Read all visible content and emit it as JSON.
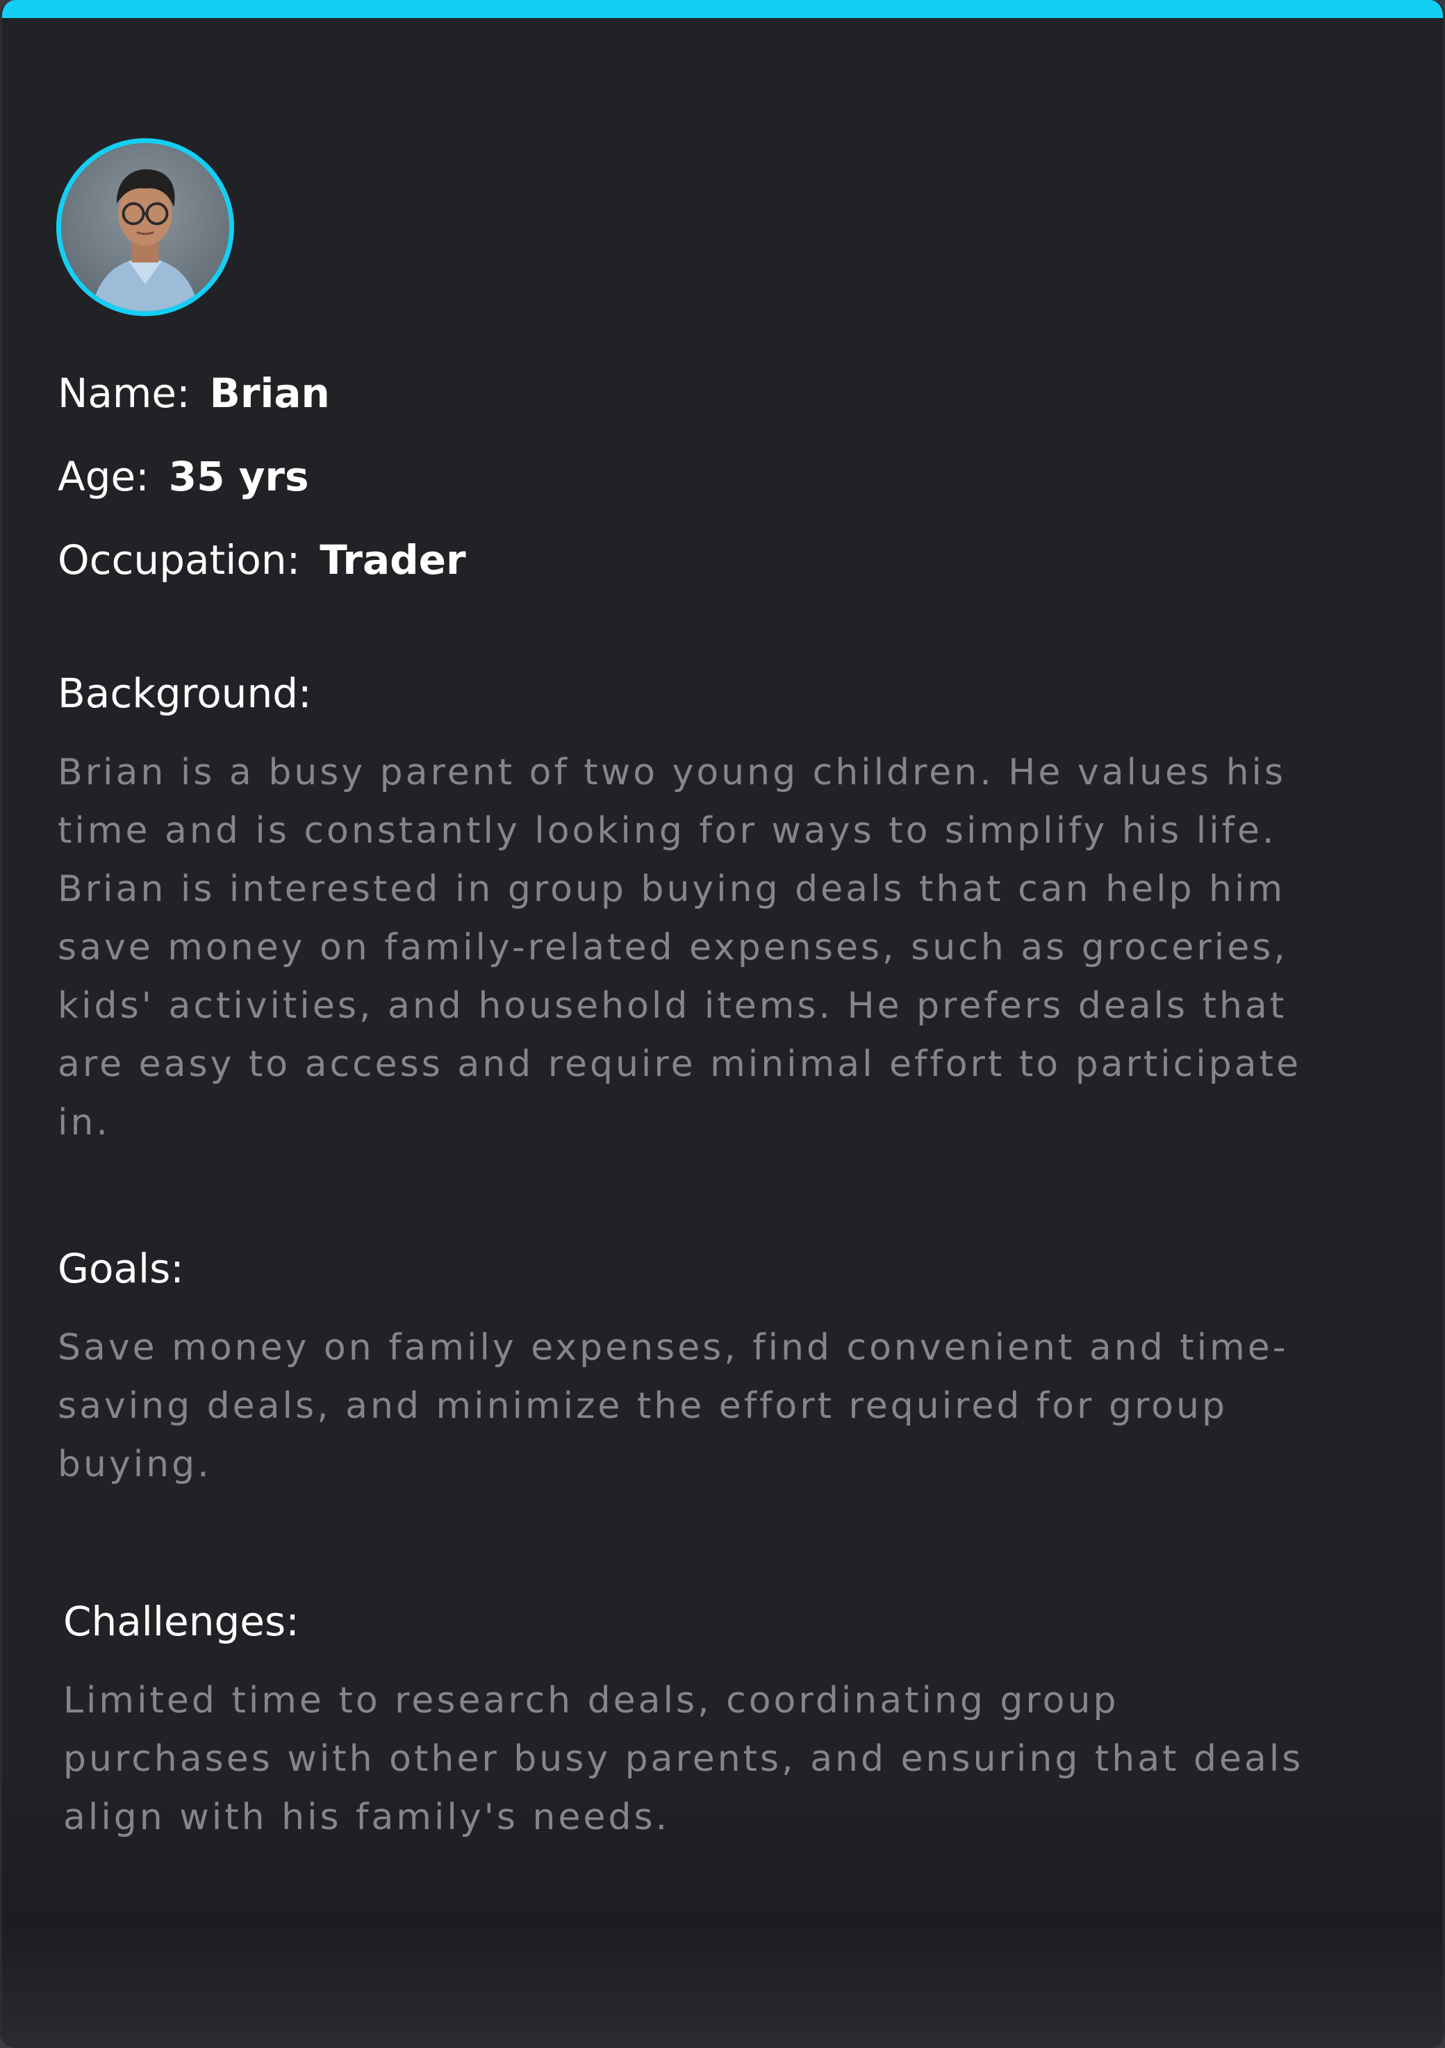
{
  "persona": {
    "avatar_alt": "avatar",
    "fields": {
      "name_label": "Name:",
      "name_value": "Brian",
      "age_label": "Age:",
      "age_value": "35 yrs",
      "occupation_label": "Occupation:",
      "occupation_value": "Trader"
    },
    "background": {
      "title": "Background:",
      "lines": [
        "Brian is a busy parent of two young children. He values his",
        "time and is constantly looking for ways to simplify his life.",
        "Brian is interested in group buying deals that can help him",
        "save money on family-related expenses, such as groceries,",
        "kids' activities, and household items. He prefers deals that",
        "are easy to access and require minimal effort to participate",
        "in."
      ]
    },
    "goals": {
      "title": "Goals:",
      "lines": [
        "Save money on family expenses, find convenient and time-",
        "saving deals, and minimize the effort required for group",
        "buying."
      ]
    },
    "challenges": {
      "title": "Challenges:",
      "lines": [
        "Limited time to research deals, coordinating group",
        "purchases with other busy parents, and ensuring that deals",
        "align with his family's needs."
      ]
    }
  },
  "colors": {
    "accent": "#14cff4",
    "card_background": "#212226",
    "heading_text": "#ffffff",
    "body_text": "#85868b"
  }
}
